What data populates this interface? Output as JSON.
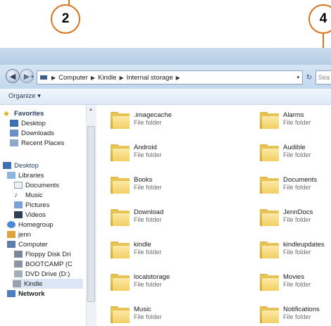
{
  "callouts": [
    {
      "label": "2"
    },
    {
      "label": "4"
    }
  ],
  "address_bar": {
    "path": [
      "Computer",
      "Kindle",
      "Internal storage"
    ],
    "search_placeholder": "Sea"
  },
  "toolbar": {
    "organize_label": "Organize ▾"
  },
  "nav_pane": {
    "items": [
      {
        "label": "Favorites",
        "icon": "star-icon"
      },
      {
        "label": "Desktop",
        "icon": "desktop-icon"
      },
      {
        "label": "Downloads",
        "icon": "downloads-icon"
      },
      {
        "label": "Recent Places",
        "icon": "recent-places-icon"
      },
      {
        "label": "Desktop",
        "icon": "desktop-icon"
      },
      {
        "label": "Libraries",
        "icon": "libraries-icon"
      },
      {
        "label": "Documents",
        "icon": "documents-icon"
      },
      {
        "label": "Music",
        "icon": "music-icon"
      },
      {
        "label": "Pictures",
        "icon": "pictures-icon"
      },
      {
        "label": "Videos",
        "icon": "videos-icon"
      },
      {
        "label": "Homegroup",
        "icon": "homegroup-icon"
      },
      {
        "label": "jenn",
        "icon": "user-icon"
      },
      {
        "label": "Computer",
        "icon": "computer-icon"
      },
      {
        "label": "Floppy Disk Dri",
        "icon": "floppy-icon"
      },
      {
        "label": "BOOTCAMP (C",
        "icon": "drive-icon"
      },
      {
        "label": "DVD Drive (D:)",
        "icon": "dvd-icon"
      },
      {
        "label": "Kindle",
        "icon": "kindle-icon"
      },
      {
        "label": "Network",
        "icon": "network-icon"
      }
    ]
  },
  "folders": [
    {
      "name": ".imagecache",
      "type": "File folder"
    },
    {
      "name": "Alarms",
      "type": "File folder"
    },
    {
      "name": "Android",
      "type": "File folder"
    },
    {
      "name": "Audible",
      "type": "File folder"
    },
    {
      "name": "Books",
      "type": "File folder"
    },
    {
      "name": "Documents",
      "type": "File folder"
    },
    {
      "name": "Download",
      "type": "File folder"
    },
    {
      "name": "JennDocs",
      "type": "File folder"
    },
    {
      "name": "kindle",
      "type": "File folder"
    },
    {
      "name": "kindleupdates",
      "type": "File folder"
    },
    {
      "name": "localstorage",
      "type": "File folder"
    },
    {
      "name": "Movies",
      "type": "File folder"
    },
    {
      "name": "Music",
      "type": "File folder"
    },
    {
      "name": "Notifications",
      "type": "File folder"
    }
  ],
  "colors": {
    "callout_border": "#d9741c",
    "folder": "#f2cf62",
    "chrome": "#c3d7ee"
  }
}
